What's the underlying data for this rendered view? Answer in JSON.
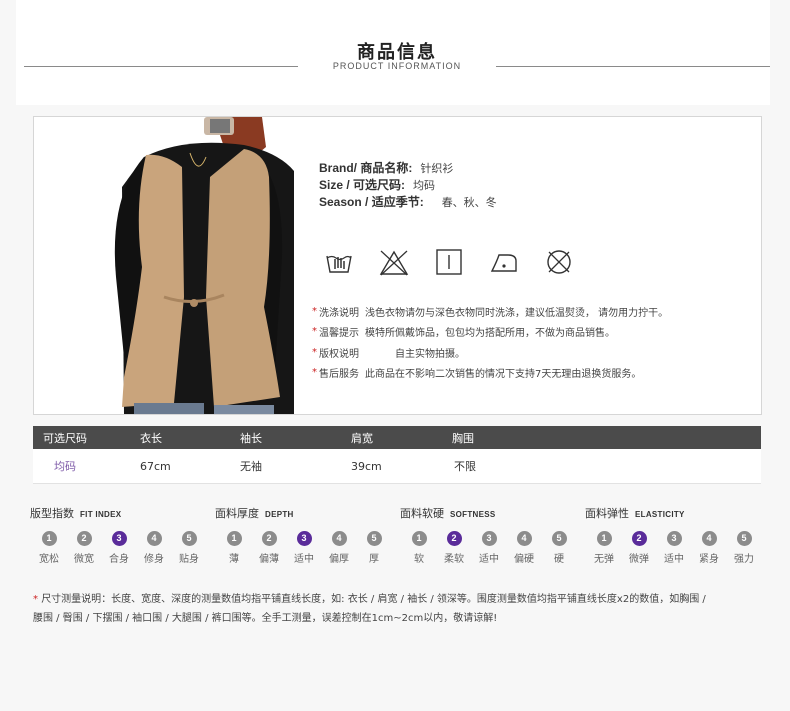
{
  "header": {
    "title": "商品信息",
    "subtitle": "PRODUCT INFORMATION"
  },
  "product": {
    "brand_label": "Brand/ 商品名称:",
    "brand_value": "针织衫",
    "size_label": "Size / 可选尺码:",
    "size_value": "均码",
    "season_label": "Season / 适应季节:",
    "season_value": "春、秋、冬",
    "care_icons": [
      "hand-wash-icon",
      "do-not-bleach-icon",
      "line-dry-icon",
      "iron-low-icon",
      "do-not-dry-clean-icon"
    ],
    "notes": [
      {
        "label": "洗涤说明",
        "text": "浅色衣物请勿与深色衣物同时洗涤，建议低温熨烫， 请勿用力拧干。"
      },
      {
        "label": "温馨提示",
        "text": "模特所佩戴饰品，包包均为搭配所用，不做为商品销售。"
      },
      {
        "label": "版权说明",
        "text": "自主实物拍摄。"
      },
      {
        "label": "售后服务",
        "text": "此商品在不影响二次销售的情况下支持7天无理由退换货服务。"
      }
    ]
  },
  "size_table": {
    "headers": [
      "可选尺码",
      "衣长",
      "袖长",
      "肩宽",
      "胸围"
    ],
    "row": [
      "均码",
      "67cm",
      "无袖",
      "39cm",
      "不限"
    ]
  },
  "scales": [
    {
      "title": "版型指数",
      "title_en": "FIT INDEX",
      "labels": [
        "宽松",
        "微宽",
        "合身",
        "修身",
        "贴身"
      ],
      "active_index": 3
    },
    {
      "title": "面料厚度",
      "title_en": "DEPTH",
      "labels": [
        "薄",
        "偏薄",
        "适中",
        "偏厚",
        "厚"
      ],
      "active_index": 3
    },
    {
      "title": "面料软硬",
      "title_en": "SOFTNESS",
      "labels": [
        "软",
        "柔软",
        "适中",
        "偏硬",
        "硬"
      ],
      "active_index": 2
    },
    {
      "title": "面料弹性",
      "title_en": "ELASTICITY",
      "labels": [
        "无弹",
        "微弹",
        "适中",
        "紧身",
        "强力"
      ],
      "active_index": 2
    }
  ],
  "scale_numbers": [
    "1",
    "2",
    "3",
    "4",
    "5"
  ],
  "footnote": {
    "label": "尺寸测量说明",
    "line1": "：长度、宽度、深度的测量数值均指平铺直线长度，如: 衣长 / 肩宽 / 袖长 / 领深等。围度测量数值均指平铺直线长度x2的数值，如胸围 /",
    "line2": "腰围 / 臀围 / 下摆围 / 袖口围 / 大腿围 / 裤口围等。全手工测量，误差控制在1cm~2cm以内，敬请谅解!"
  },
  "colors": {
    "accent_purple": "#5a2c9a",
    "dot_gray": "#8c8c8c",
    "table_header": "#4b4b4b",
    "note_star": "#cc2222"
  }
}
